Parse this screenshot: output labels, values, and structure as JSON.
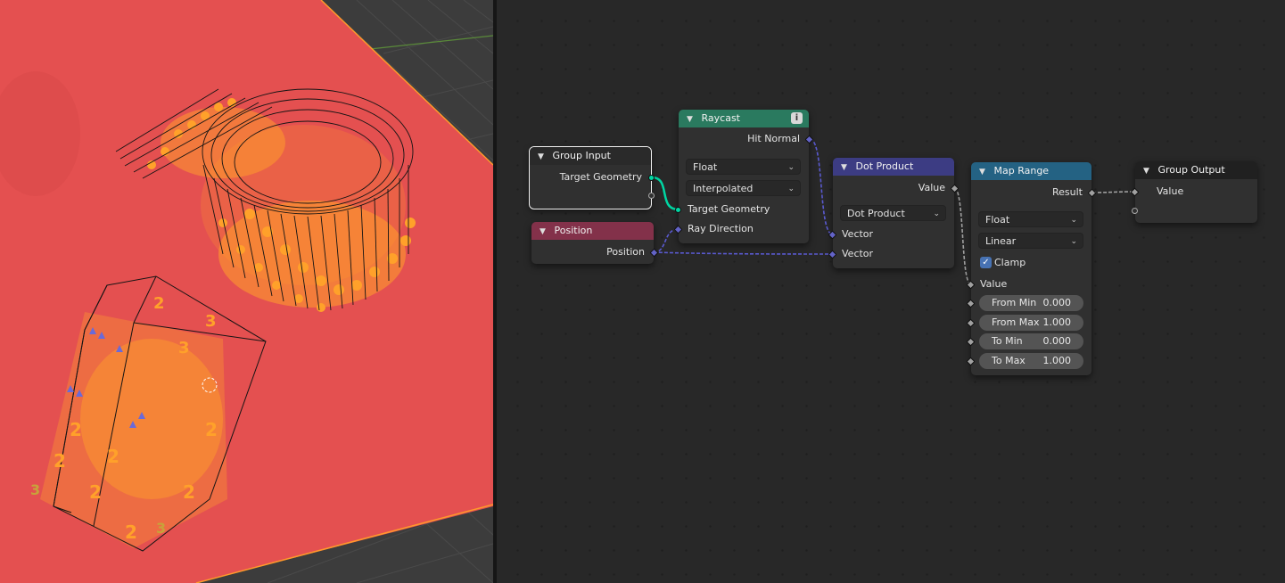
{
  "colors": {
    "ground_plane": "#e45050",
    "points": "#ffa12a",
    "viewport_bg": "#3c3c3c",
    "editor_bg": "#282828",
    "header_input": "#2a2a2a",
    "header_raycast": "#2a7a5f",
    "header_position": "#83314a",
    "header_converter": "#3c3c83",
    "header_map_range": "#246283",
    "socket_geometry": "#00d6a3",
    "socket_vector": "#6363c7",
    "socket_float": "#a1a1a1",
    "link_vector": "#5a5ad0"
  },
  "viewport": {
    "labels": [
      "2",
      "3",
      "2",
      "2",
      "3",
      "2",
      "3",
      "2",
      "2",
      "2",
      "3",
      "2"
    ]
  },
  "nodes": {
    "group_input": {
      "title": "Group Input",
      "out_target": "Target Geometry"
    },
    "position": {
      "title": "Position",
      "out_position": "Position"
    },
    "raycast": {
      "title": "Raycast",
      "info_icon": "info-icon",
      "out_hit_normal": "Hit Normal",
      "type_value": "Float",
      "mode_value": "Interpolated",
      "in_target": "Target Geometry",
      "in_ray_dir": "Ray Direction"
    },
    "dot_product": {
      "title": "Dot Product",
      "out_value": "Value",
      "op_value": "Dot Product",
      "in_vec1": "Vector",
      "in_vec2": "Vector"
    },
    "map_range": {
      "title": "Map Range",
      "out_result": "Result",
      "type_value": "Float",
      "interp_value": "Linear",
      "clamp_label": "Clamp",
      "clamp_checked": true,
      "in_value": "Value",
      "fields": [
        {
          "label": "From Min",
          "value": "0.000"
        },
        {
          "label": "From Max",
          "value": "1.000"
        },
        {
          "label": "To Min",
          "value": "0.000"
        },
        {
          "label": "To Max",
          "value": "1.000"
        }
      ]
    },
    "group_output": {
      "title": "Group Output",
      "in_value": "Value"
    }
  }
}
